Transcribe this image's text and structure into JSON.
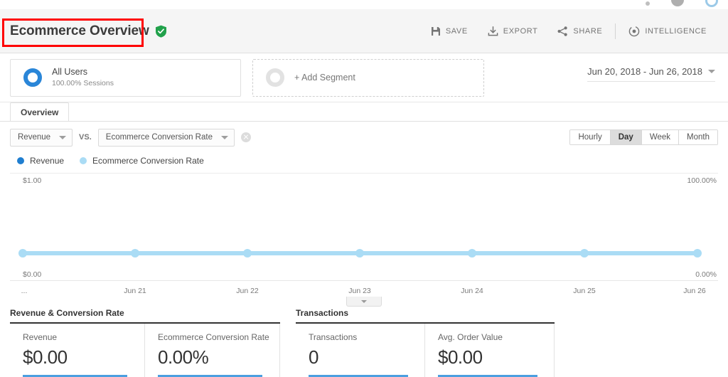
{
  "topbar": {
    "icons": [
      "more-dot-icon",
      "account-avatar-icon",
      "notifications-icon"
    ]
  },
  "header": {
    "title": "Ecommerce Overview",
    "verified_icon": "green-shield-check-icon",
    "highlight_color": "#ff0000",
    "actions": [
      {
        "label": "SAVE",
        "icon": "save-floppy-icon"
      },
      {
        "label": "EXPORT",
        "icon": "export-download-icon"
      },
      {
        "label": "SHARE",
        "icon": "share-nodes-icon"
      },
      {
        "label": "INTELLIGENCE",
        "icon": "intelligence-icon"
      }
    ]
  },
  "segments": {
    "primary": {
      "name": "All Users",
      "sub": "100.00% Sessions",
      "icon": "blue-donut-icon"
    },
    "add": {
      "label": "+ Add Segment",
      "icon": "gray-donut-icon"
    }
  },
  "date_range": {
    "value": "Jun 20, 2018 - Jun 26, 2018",
    "icon": "chevron-down-icon"
  },
  "tabs": [
    {
      "label": "Overview",
      "active": true
    }
  ],
  "controls": {
    "metric_primary": "Revenue",
    "vs_label": "VS.",
    "metric_secondary": "Ecommerce Conversion Rate",
    "remove_icon": "close-circle-icon",
    "granularity": [
      {
        "label": "Hourly",
        "active": false
      },
      {
        "label": "Day",
        "active": true
      },
      {
        "label": "Week",
        "active": false
      },
      {
        "label": "Month",
        "active": false
      }
    ]
  },
  "legend": [
    {
      "label": "Revenue",
      "color": "#1f7ed0"
    },
    {
      "label": "Ecommerce Conversion Rate",
      "color": "#aadcf5"
    }
  ],
  "chart_data": {
    "type": "line",
    "title": "",
    "xlabel": "",
    "ylabel": "Revenue",
    "categories": [
      "...",
      "Jun 21",
      "Jun 22",
      "Jun 23",
      "Jun 24",
      "Jun 25",
      "Jun 26"
    ],
    "series": [
      {
        "name": "Revenue",
        "color": "#1f7ed0",
        "values": [
          0,
          0,
          0,
          0,
          0,
          0,
          0
        ]
      },
      {
        "name": "Ecommerce Conversion Rate",
        "color": "#aadcf5",
        "values": [
          0,
          0,
          0,
          0,
          0,
          0,
          0
        ]
      }
    ],
    "y_left_axis": {
      "max_label": "$1.00",
      "min_label": "$0.00",
      "ylim": [
        0,
        1
      ]
    },
    "y_right_axis": {
      "max_label": "100.00%",
      "min_label": "0.00%",
      "ylim": [
        0,
        100
      ]
    },
    "grid": false,
    "legend_position": "top-left",
    "markers": true
  },
  "collapse_control": {
    "icon": "chevron-down-icon"
  },
  "modules": [
    {
      "title": "Revenue & Conversion Rate",
      "metrics": [
        {
          "label": "Revenue",
          "value": "$0.00"
        },
        {
          "label": "Ecommerce Conversion Rate",
          "value": "0.00%"
        }
      ]
    },
    {
      "title": "Transactions",
      "metrics": [
        {
          "label": "Transactions",
          "value": "0"
        },
        {
          "label": "Avg. Order Value",
          "value": "$0.00"
        }
      ]
    }
  ]
}
